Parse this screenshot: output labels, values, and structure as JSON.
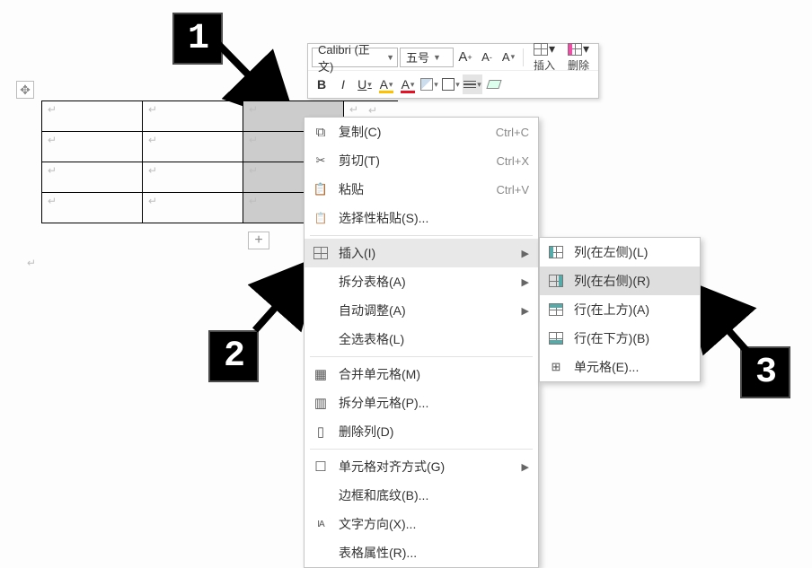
{
  "annotation_labels": [
    "1",
    "2",
    "3"
  ],
  "toolbar": {
    "font_name": "Calibri (正文)",
    "font_size": "五号",
    "increase_font": "A⁺",
    "decrease_font": "A⁻",
    "bold": "B",
    "italic": "I",
    "underline": "U",
    "fontcolor_letter": "A",
    "highlight_letter": "A",
    "insert_label": "插入",
    "delete_label": "删除"
  },
  "table": {
    "rows": 4,
    "cols": 4,
    "selected_col_index": 2,
    "cell_mark": "↵"
  },
  "context_menu": [
    {
      "icon": "ico-copy",
      "label": "复制(C)",
      "shortcut": "Ctrl+C"
    },
    {
      "icon": "ico-cut",
      "label": "剪切(T)",
      "shortcut": "Ctrl+X"
    },
    {
      "icon": "ico-paste",
      "label": "粘贴",
      "shortcut": "Ctrl+V"
    },
    {
      "icon": "ico-paste-sp",
      "label": "选择性粘贴(S)..."
    },
    {
      "sep": true
    },
    {
      "icon": "grid-icon",
      "label": "插入(I)",
      "submenu": true,
      "highlight": true
    },
    {
      "label": "拆分表格(A)",
      "submenu": true
    },
    {
      "label": "自动调整(A)",
      "submenu": true
    },
    {
      "label": "全选表格(L)"
    },
    {
      "sep": true
    },
    {
      "icon": "ico-merge",
      "label": "合并单元格(M)"
    },
    {
      "icon": "ico-splitcell",
      "label": "拆分单元格(P)..."
    },
    {
      "icon": "ico-delcol",
      "label": "删除列(D)"
    },
    {
      "sep": true
    },
    {
      "icon": "ico-align",
      "label": "单元格对齐方式(G)",
      "submenu": true
    },
    {
      "label": "边框和底纹(B)..."
    },
    {
      "icon": "ico-textdir",
      "label": "文字方向(X)..."
    },
    {
      "label": "表格属性(R)..."
    }
  ],
  "submenu": [
    {
      "iconClass": "ico-ins-left",
      "label": "列(在左侧)(L)"
    },
    {
      "iconClass": "ico-ins-right",
      "label": "列(在右侧)(R)",
      "highlight": true
    },
    {
      "iconClass": "ico-ins-top",
      "label": "行(在上方)(A)"
    },
    {
      "iconClass": "ico-ins-bot",
      "label": "行(在下方)(B)"
    },
    {
      "iconClass": "ico-cell",
      "label": "单元格(E)..."
    }
  ]
}
